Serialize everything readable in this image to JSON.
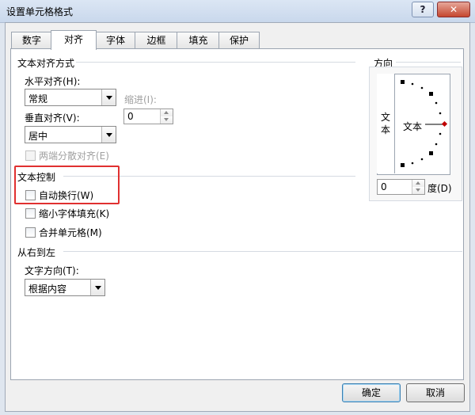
{
  "window": {
    "title": "设置单元格格式",
    "help_label": "?",
    "close_label": "✕"
  },
  "tabs": [
    {
      "label": "数字"
    },
    {
      "label": "对齐"
    },
    {
      "label": "字体"
    },
    {
      "label": "边框"
    },
    {
      "label": "填充"
    },
    {
      "label": "保护"
    }
  ],
  "active_tab": "对齐",
  "alignment": {
    "section_title": "文本对齐方式",
    "horizontal_label": "水平对齐(H):",
    "horizontal_value": "常规",
    "indent_label": "缩进(I):",
    "indent_value": "0",
    "vertical_label": "垂直对齐(V):",
    "vertical_value": "居中",
    "distributed_label": "两端分散对齐(E)"
  },
  "text_control": {
    "section_title": "文本控制",
    "wrap_text_label": "自动换行(W)",
    "shrink_to_fit_label": "缩小字体填充(K)",
    "merge_cells_label": "合并单元格(M)"
  },
  "rtl": {
    "section_title": "从右到左",
    "direction_label": "文字方向(T):",
    "direction_value": "根据内容"
  },
  "orientation": {
    "section_title": "方向",
    "vertical_text": "文本",
    "dial_text": "文本",
    "degree_value": "0",
    "degree_label": "度(D)"
  },
  "footer": {
    "ok_label": "确定",
    "cancel_label": "取消"
  }
}
